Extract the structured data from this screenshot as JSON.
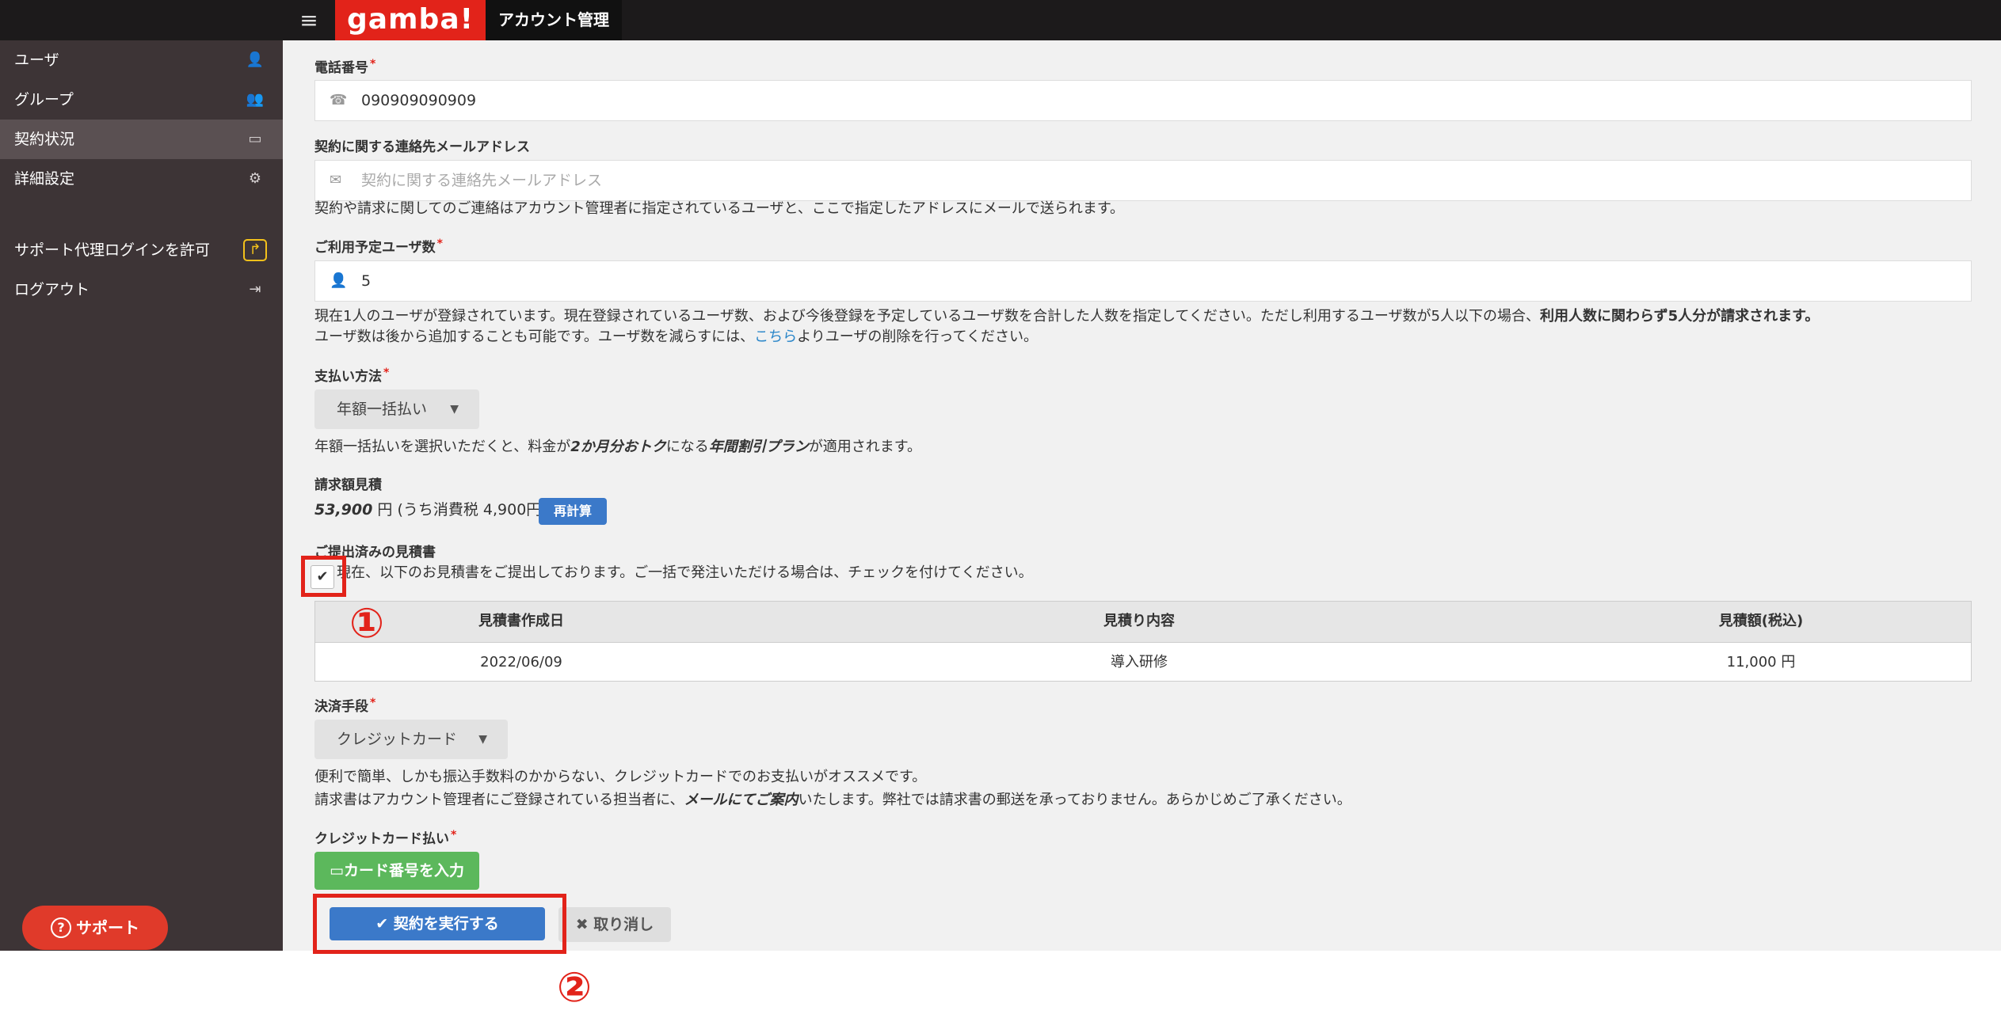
{
  "topbar": {
    "menu_icon": "hamburger-icon",
    "logo": "gamba!",
    "app_title": "アカウント管理"
  },
  "sidebar": {
    "items": [
      {
        "label": "ユーザ",
        "icon": "user-add-icon"
      },
      {
        "label": "グループ",
        "icon": "group-icon"
      },
      {
        "label": "契約状況",
        "icon": "credit-card-icon",
        "active": true
      },
      {
        "label": "詳細設定",
        "icon": "gears-icon"
      },
      {
        "label": "サポート代理ログインを許可",
        "icon": "share-icon"
      },
      {
        "label": "ログアウト",
        "icon": "sign-out-icon"
      }
    ],
    "support_button": "サポート"
  },
  "form": {
    "phone": {
      "label": "電話番号",
      "value": "090909090909"
    },
    "contact_email": {
      "label": "契約に関する連絡先メールアドレス",
      "placeholder": "契約に関する連絡先メールアドレス",
      "help": "契約や請求に関してのご連絡はアカウント管理者に指定されているユーザと、ここで指定したアドレスにメールで送られます。"
    },
    "user_count": {
      "label": "ご利用予定ユーザ数",
      "value": "5",
      "help_line1_a": "現在1人のユーザが登録されています。現在登録されているユーザ数、および今後登録を予定しているユーザ数を合計した人数を指定してください。ただし利用するユーザ数が5人以下の場合、",
      "help_line1_b": "利用人数に関わらず5人分が請求されます。",
      "help_line2_a": "ユーザ数は後から追加することも可能です。ユーザ数を減らすには、",
      "help_line2_link": "こちら",
      "help_line2_b": "よりユーザの削除を行ってください。"
    },
    "payment_method": {
      "label": "支払い方法",
      "value": "年額一括払い",
      "help_a": "年額一括払いを選択いただくと、料金が",
      "help_b": "2か月分おトク",
      "help_c": "になる",
      "help_d": "年間割引プラン",
      "help_e": "が適用されます。"
    },
    "estimate": {
      "label": "請求額見積",
      "amount": "53,900",
      "unit": "円",
      "tax": "(うち消費税 4,900円)",
      "recalc_button": "再計算"
    },
    "submitted_quotes": {
      "label": "ご提出済みの見積書",
      "checkbox_text": "現在、以下のお見積書をご提出しております。ご一括で発注いただける場合は、チェックを付けてください。",
      "checked": true,
      "columns": [
        "見積書作成日",
        "見積り内容",
        "見積額(税込)"
      ],
      "rows": [
        {
          "date": "2022/06/09",
          "content": "導入研修",
          "amount": "11,000 円"
        }
      ]
    },
    "settlement": {
      "label": "決済手段",
      "value": "クレジットカード",
      "help_line1": "便利で簡単、しかも振込手数料のかからない、クレジットカードでのお支払いがオススメです。",
      "help_line2_a": "請求書はアカウント管理者にご登録されている担当者に、",
      "help_line2_b": "メールにてご案内",
      "help_line2_c": "いたします。弊社では請求書の郵送を承っておりません。あらかじめご了承ください。"
    },
    "credit_card": {
      "label": "クレジットカード払い",
      "button": "カード番号を入力"
    },
    "submit_button": "契約を実行する",
    "cancel_button": "取り消し"
  },
  "annotations": {
    "marker_1": "①",
    "marker_2": "②",
    "color": "#e2231a"
  }
}
